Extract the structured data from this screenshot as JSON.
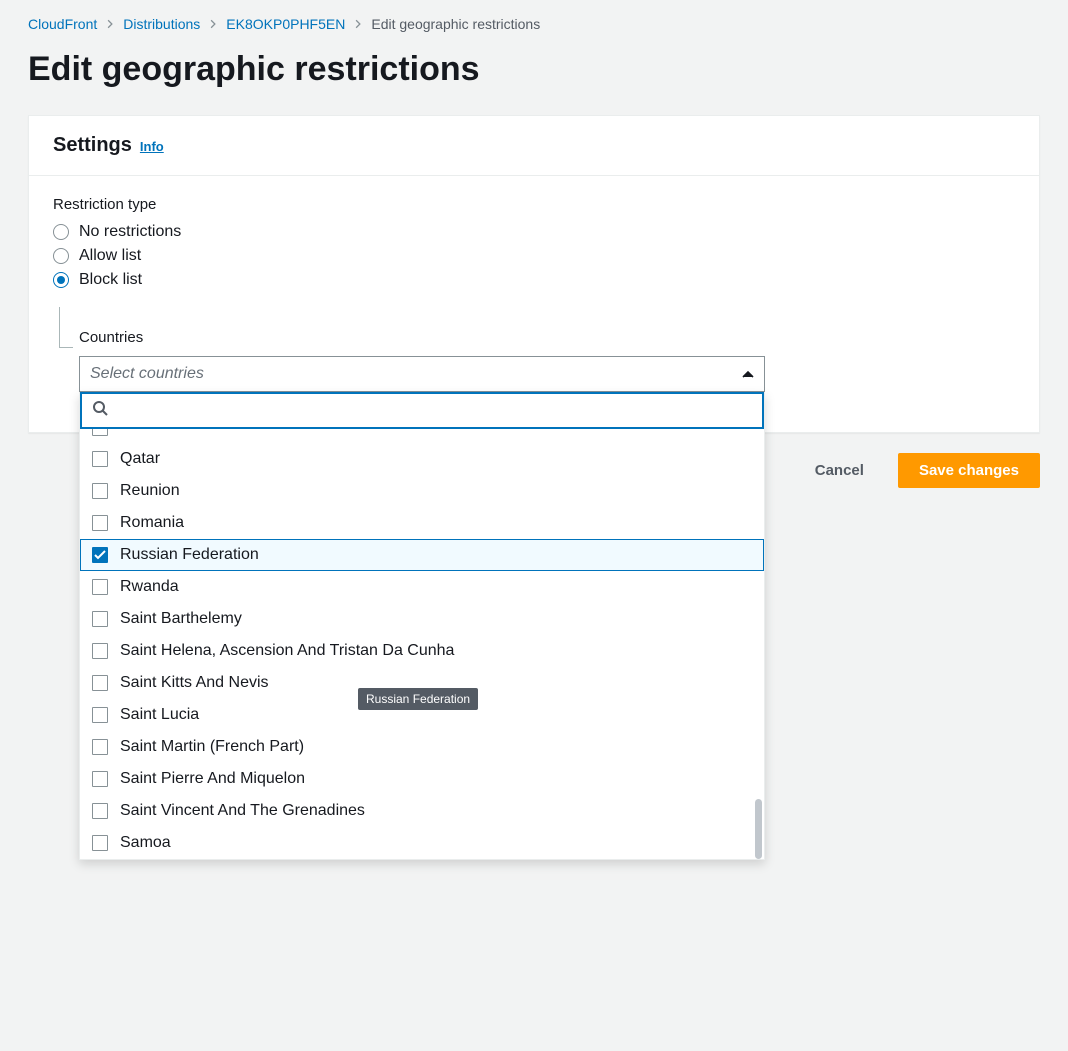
{
  "breadcrumb": {
    "items": [
      {
        "label": "CloudFront"
      },
      {
        "label": "Distributions"
      },
      {
        "label": "EK8OKP0PHF5EN"
      }
    ],
    "current": "Edit geographic restrictions"
  },
  "page_title": "Edit geographic restrictions",
  "panel": {
    "header": "Settings",
    "info": "Info",
    "restriction_type_label": "Restriction type",
    "restriction_options": {
      "none": "No restrictions",
      "allow": "Allow list",
      "block": "Block list"
    },
    "restriction_selected": "block",
    "countries_label": "Countries",
    "multiselect": {
      "placeholder": "Select countries",
      "search_value": "",
      "options": [
        {
          "label": "Qatar",
          "checked": false
        },
        {
          "label": "Reunion",
          "checked": false
        },
        {
          "label": "Romania",
          "checked": false
        },
        {
          "label": "Russian Federation",
          "checked": true,
          "highlighted": true
        },
        {
          "label": "Rwanda",
          "checked": false
        },
        {
          "label": "Saint Barthelemy",
          "checked": false
        },
        {
          "label": "Saint Helena, Ascension And Tristan Da Cunha",
          "checked": false
        },
        {
          "label": "Saint Kitts And Nevis",
          "checked": false
        },
        {
          "label": "Saint Lucia",
          "checked": false
        },
        {
          "label": "Saint Martin (French Part)",
          "checked": false
        },
        {
          "label": "Saint Pierre And Miquelon",
          "checked": false
        },
        {
          "label": "Saint Vincent And The Grenadines",
          "checked": false
        },
        {
          "label": "Samoa",
          "checked": false
        }
      ]
    }
  },
  "tooltip": "Russian Federation",
  "actions": {
    "cancel": "Cancel",
    "save": "Save changes"
  }
}
